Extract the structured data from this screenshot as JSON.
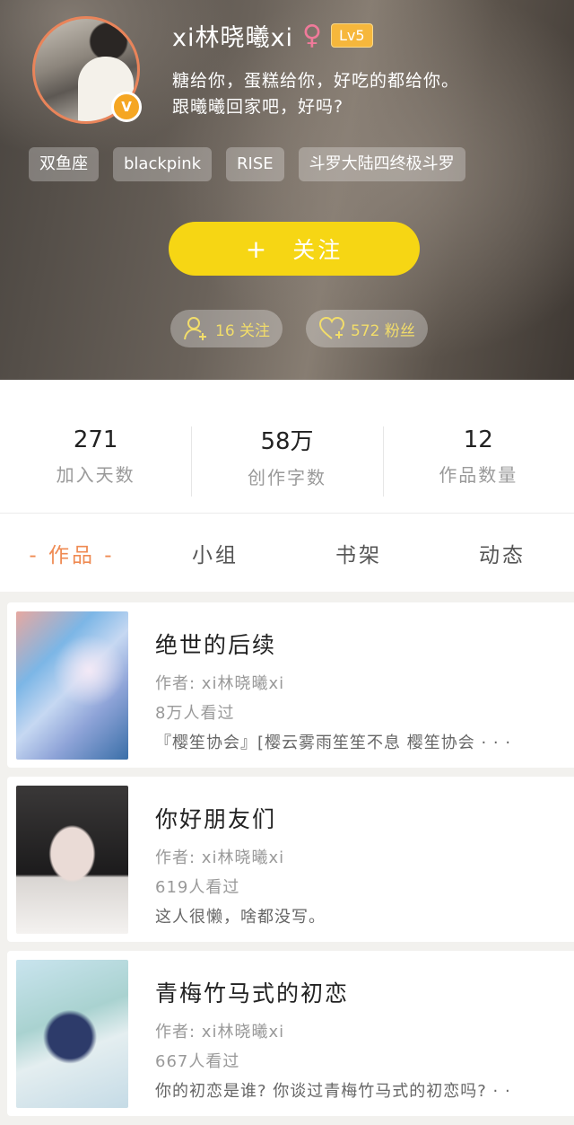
{
  "profile": {
    "username": "xi林晓曦xi",
    "gender_icon": "female-icon",
    "level": "Lv5",
    "verified_badge": "V",
    "bio_line1": "糖给你，蛋糕给你，好吃的都给你。",
    "bio_line2": "跟曦曦回家吧，好吗?",
    "tags": [
      "双鱼座",
      "blackpink",
      "RISE",
      "斗罗大陆四终极斗罗"
    ],
    "follow_plus": "+",
    "follow_label": "关注",
    "following_pill": "16 关注",
    "followers_pill": "572 粉丝"
  },
  "stats": [
    {
      "value": "271",
      "label": "加入天数"
    },
    {
      "value": "58万",
      "label": "创作字数"
    },
    {
      "value": "12",
      "label": "作品数量"
    }
  ],
  "tabs": [
    {
      "label": "- 作品 -",
      "active": true
    },
    {
      "label": "小组",
      "active": false
    },
    {
      "label": "书架",
      "active": false
    },
    {
      "label": "动态",
      "active": false
    }
  ],
  "works": [
    {
      "title": "绝世的后续",
      "author": "作者: xi林晓曦xi",
      "views": "8万人看过",
      "desc": "『樱笙协会』[樱云雾雨笙笙不息 樱笙协会 · · ·"
    },
    {
      "title": "你好朋友们",
      "author": "作者: xi林晓曦xi",
      "views": "619人看过",
      "desc": "这人很懒，啥都没写。"
    },
    {
      "title": "青梅竹马式的初恋",
      "author": "作者: xi林晓曦xi",
      "views": "667人看过",
      "desc": "你的初恋是谁? 你谈过青梅竹马式的初恋吗? · · ·"
    }
  ],
  "colors": {
    "accent_yellow": "#f6d614",
    "tab_active": "#ef8a52",
    "gender_pink": "#f07a9a",
    "level_badge": "#f6b73c"
  }
}
